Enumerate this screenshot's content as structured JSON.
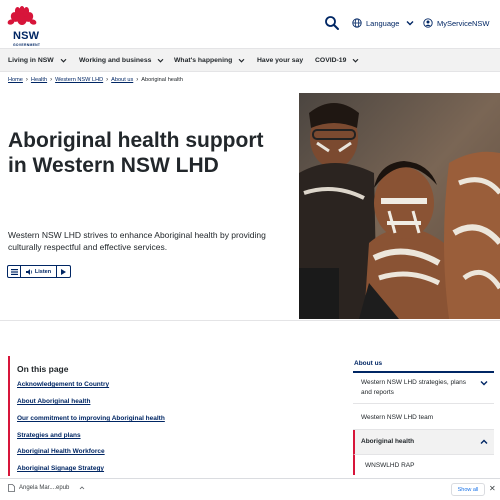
{
  "header": {
    "logo_text": "NSW",
    "logo_subtext": "GOVERNMENT",
    "search_icon": "search-icon",
    "language_label": "Language",
    "myservice_label": "MyServiceNSW"
  },
  "nav": {
    "items": [
      {
        "label": "Living in NSW",
        "has_chevron": true
      },
      {
        "label": "Working and business",
        "has_chevron": true
      },
      {
        "label": "What's happening",
        "has_chevron": true
      },
      {
        "label": "Have your say",
        "has_chevron": false
      },
      {
        "label": "COVID-19",
        "has_chevron": true
      }
    ]
  },
  "breadcrumb": {
    "items": [
      "Home",
      "Health",
      "Western NSW LHD",
      "About us",
      "Aboriginal health"
    ]
  },
  "hero": {
    "title": "Aboriginal health support in Western NSW LHD",
    "intro": "Western NSW LHD strives to enhance Aboriginal health by providing culturally respectful and effective services.",
    "listen_label": "Listen"
  },
  "on_this_page": {
    "title": "On this page",
    "links": [
      "Acknowledgement to Country",
      "About Aboriginal health",
      "Our commitment to improving Aboriginal health",
      "Strategies and plans",
      "Aboriginal Health Workforce",
      "Aboriginal Signage Strategy"
    ]
  },
  "sidebar": {
    "title": "About us",
    "items": [
      {
        "label": "Western NSW LHD strategies, plans and reports",
        "expandable": true
      },
      {
        "label": "Western NSW LHD team",
        "expandable": false
      },
      {
        "label": "Aboriginal health",
        "expandable": true,
        "active": true
      },
      {
        "label": "WNSWLHD RAP",
        "expandable": false
      }
    ]
  },
  "downloads": {
    "file_name": "Angela Mar....epub",
    "show_all": "Show all",
    "close": "✕"
  },
  "colors": {
    "brand_navy": "#002664",
    "brand_red": "#d7153a",
    "nav_bg": "#f2f2f2"
  }
}
